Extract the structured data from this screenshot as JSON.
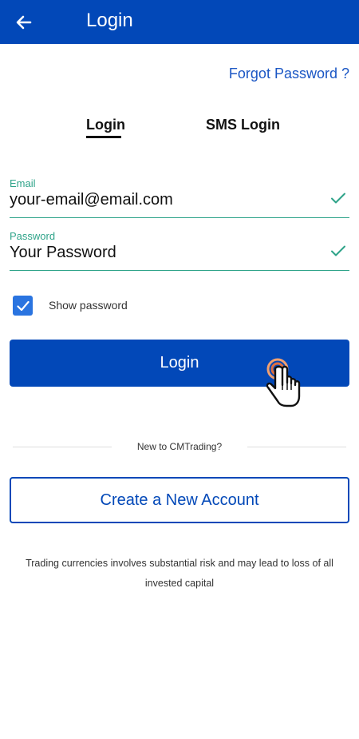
{
  "header": {
    "title": "Login",
    "back_icon": "arrow-left-icon"
  },
  "forgot_password": "Forgot Password ?",
  "tabs": [
    {
      "label": "Login",
      "active": true
    },
    {
      "label": "SMS Login",
      "active": false
    }
  ],
  "form": {
    "email": {
      "label": "Email",
      "value": "your-email@email.com",
      "valid": true
    },
    "password": {
      "label": "Password",
      "value": "Your Password",
      "valid": true
    },
    "show_password": {
      "label": "Show password",
      "checked": true
    }
  },
  "login_button": "Login",
  "new_user_prompt": "New to CMTrading?",
  "create_account_button": "Create a New Account",
  "disclaimer": "Trading currencies involves substantial risk and may lead to loss of all invested capital",
  "colors": {
    "primary": "#0248b8",
    "valid": "#2ea389",
    "checkbox": "#2a74e0"
  }
}
